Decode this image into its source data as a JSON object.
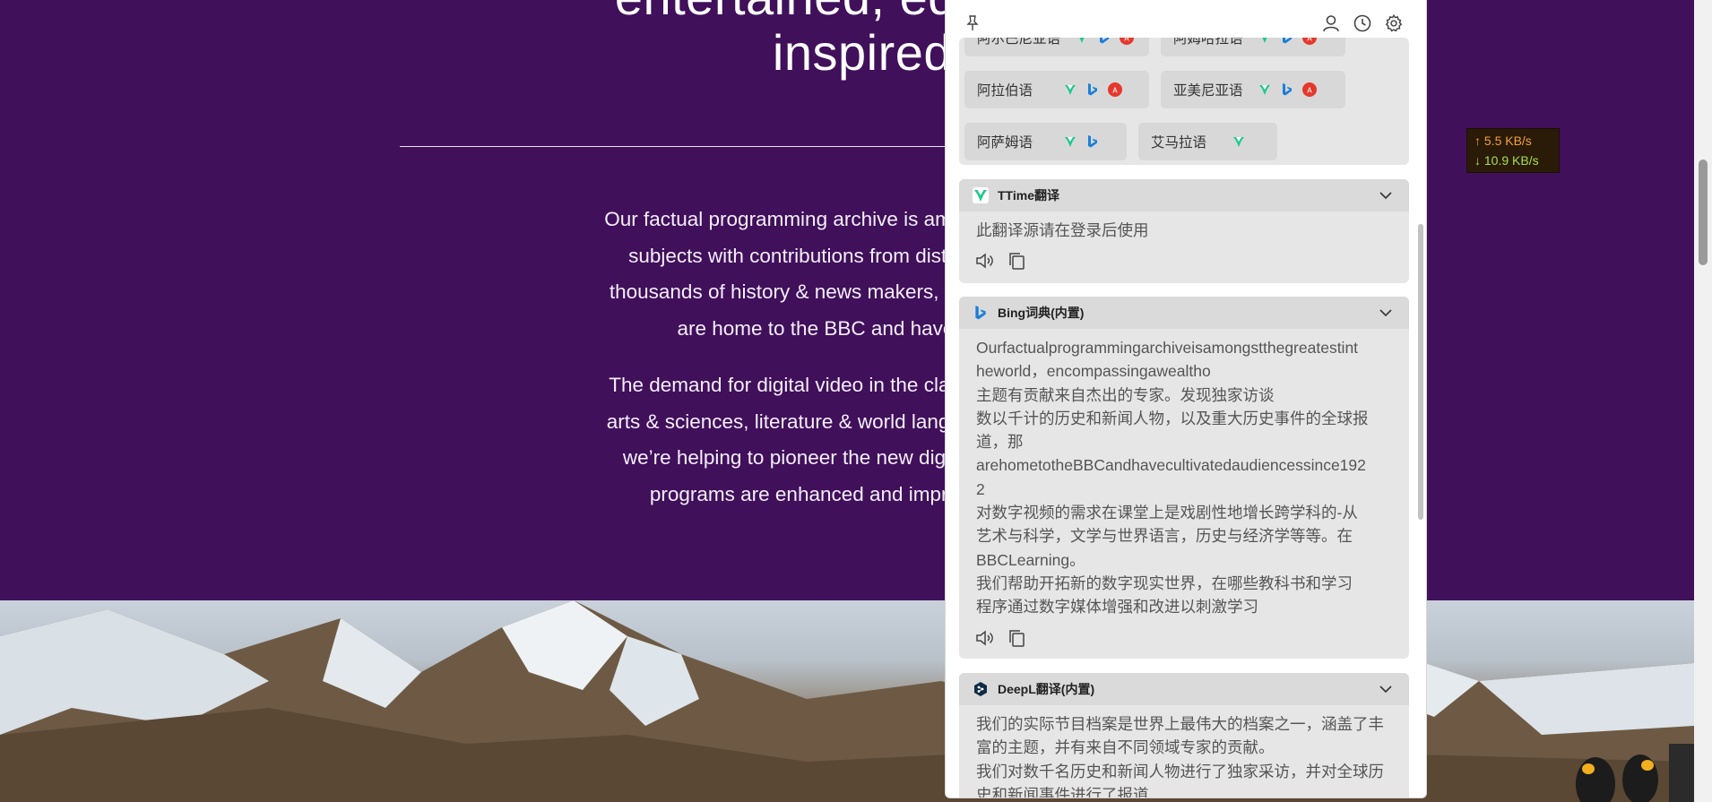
{
  "page": {
    "hero_line1": "entertained, educated,",
    "hero_line2": "inspired!",
    "para1_lines": [
      "Our factual programming archive is amongst the greatest in",
      "subjects with contributions from distinguished experts.",
      "thousands of history & news makers, as well as global cov",
      "are home to the BBC and have cultivated a"
    ],
    "para2_lines": [
      "The demand for digital video in the classroom is dramatica",
      "arts & sciences, literature & world languages, history & eco",
      "we’re helping to pioneer the new digital reality — a worl",
      "programs are enhanced and improved by digital r"
    ]
  },
  "speed": {
    "upload": "↑ 5.5 KB/s",
    "download": "↓ 10.9 KB/s"
  },
  "panel": {
    "languages": [
      "阿尔巴尼亚语",
      "阿姆哈拉语",
      "阿拉伯语",
      "亚美尼亚语",
      "阿萨姆语",
      "艾马拉语"
    ],
    "ttime": {
      "title": "TTime翻译",
      "text": "此翻译源请在登录后使用"
    },
    "bing": {
      "title": "Bing词典(内置)",
      "lines": [
        "Ourfactualprogrammingarchiveisamongstthegreatestint",
        "heworld，encompassingawealtho",
        "主题有贡献来自杰出的专家。发现独家访谈",
        "数以千计的历史和新闻人物，以及重大历史事件的全球报",
        "道，那",
        "arehometotheBBCandhavecultivatedaudiencessince192",
        "2",
        "对数字视频的需求在课堂上是戏剧性地增长跨学科的-从",
        "艺术与科学，文学与世界语言，历史与经济学等等。在",
        "BBCLearning。",
        "我们帮助开拓新的数字现实世界，在哪些教科书和学习",
        "程序通过数字媒体增强和改进以刺激学习"
      ]
    },
    "deepl": {
      "title": "DeepL翻译(内置)",
      "lines": [
        "我们的实际节目档案是世界上最伟大的档案之一，涵盖了丰",
        "富的主题，并有来自不同领域专家的贡献。",
        "我们对数千名历史和新闻人物进行了独家采访，并对全球历",
        "史和新闻事件进行了报道"
      ]
    }
  },
  "colors": {
    "page_bg": "#40105a",
    "panel_bg": "#ffffff",
    "card_bg": "#e6e6e6",
    "ttime_green": "#1fc98e",
    "bing_blue": "#1b7fd8",
    "deepl_navy": "#0f2b46"
  },
  "icons": [
    "pin-icon",
    "user-icon",
    "history-icon",
    "settings-icon",
    "chevron-down-icon",
    "speaker-icon",
    "copy-icon",
    "ttime-logo-icon",
    "bing-logo-icon",
    "deepl-logo-icon"
  ]
}
